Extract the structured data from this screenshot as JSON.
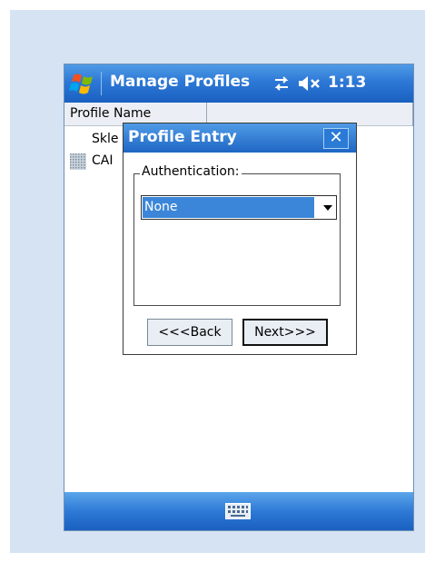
{
  "titlebar": {
    "title": "Manage Profiles",
    "time": "1:13",
    "icons": [
      "windows-start-icon",
      "connectivity-icon",
      "volume-muted-icon"
    ]
  },
  "list": {
    "columns": [
      "Profile Name",
      ""
    ],
    "rows": [
      {
        "name": "Skle",
        "icon": "none"
      },
      {
        "name": "CAI",
        "icon": "profile-icon"
      }
    ]
  },
  "dialog": {
    "title": "Profile Entry",
    "close_label": "✕",
    "group_label": "Authentication:",
    "authentication_value": "None",
    "back_label": "<<<Back",
    "next_label": "Next>>>"
  },
  "bottombar": {
    "icon": "keyboard-icon"
  },
  "colors": {
    "titlebar": "#2d78d6",
    "frame_bg": "#d5e3f2",
    "selection": "#3b86d8"
  }
}
